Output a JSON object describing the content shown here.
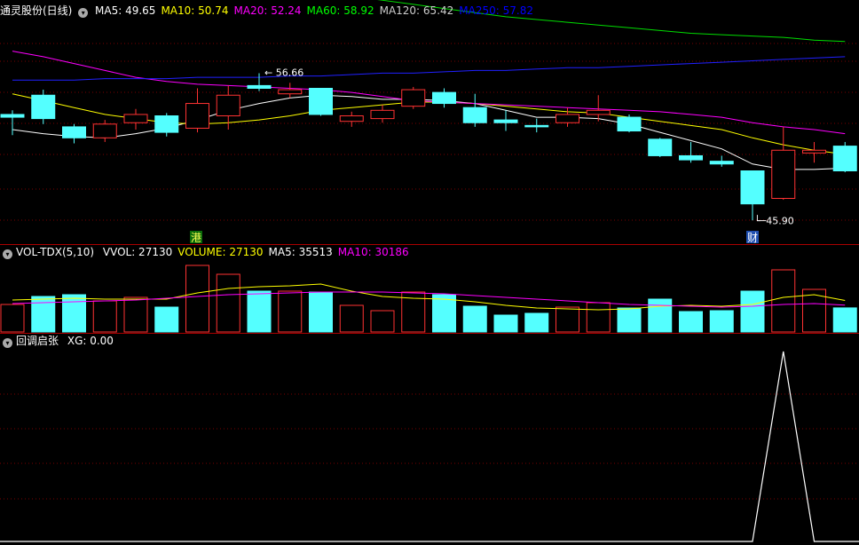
{
  "main": {
    "title": "通灵股份(日线)",
    "ma_labels": [
      {
        "key": "MA5",
        "value": "49.65",
        "color": "#ffffff"
      },
      {
        "key": "MA10",
        "value": "50.74",
        "color": "#ffff00"
      },
      {
        "key": "MA20",
        "value": "52.24",
        "color": "#ff00ff"
      },
      {
        "key": "MA60",
        "value": "58.92",
        "color": "#00ff00"
      },
      {
        "key": "MA120",
        "value": "65.42",
        "color": "#cccccc"
      },
      {
        "key": "MA250",
        "value": "57.82",
        "color": "#0000ff"
      }
    ],
    "high_label": "56.66",
    "low_label": "45.90",
    "marker_gang": "港",
    "marker_cai": "财"
  },
  "volume": {
    "title": "VOL-TDX(5,10)",
    "labels": [
      {
        "text": "VVOL: 27130",
        "color": "#ffffff"
      },
      {
        "text": "VOLUME: 27130",
        "color": "#ffff00"
      },
      {
        "text": "MA5: 35513",
        "color": "#ffffff"
      },
      {
        "text": "MA10: 30186",
        "color": "#ff00ff"
      }
    ]
  },
  "indicator": {
    "title": "回调启张",
    "labels": [
      {
        "text": "XG: 0.00",
        "color": "#ffffff"
      }
    ]
  },
  "chart_data": [
    {
      "type": "candlestick",
      "price_range": [
        44.5,
        60.5
      ],
      "candles": [
        {
          "o": 53.6,
          "c": 53.4,
          "h": 53.9,
          "l": 52.1,
          "up": false
        },
        {
          "o": 53.3,
          "c": 55.0,
          "h": 55.4,
          "l": 52.9,
          "up": false
        },
        {
          "o": 51.9,
          "c": 52.7,
          "h": 52.9,
          "l": 51.5,
          "up": false
        },
        {
          "o": 51.9,
          "c": 52.9,
          "h": 53.2,
          "l": 51.6,
          "up": true
        },
        {
          "o": 53.0,
          "c": 53.6,
          "h": 54.0,
          "l": 52.5,
          "up": true
        },
        {
          "o": 52.3,
          "c": 53.5,
          "h": 53.7,
          "l": 52.0,
          "up": false
        },
        {
          "o": 52.6,
          "c": 54.4,
          "h": 55.5,
          "l": 52.3,
          "up": true
        },
        {
          "o": 53.5,
          "c": 55.0,
          "h": 55.7,
          "l": 52.5,
          "up": true
        },
        {
          "o": 55.7,
          "c": 55.5,
          "h": 56.6,
          "l": 55.3,
          "up": false
        },
        {
          "o": 55.1,
          "c": 55.4,
          "h": 55.9,
          "l": 54.8,
          "up": true
        },
        {
          "o": 53.6,
          "c": 55.5,
          "h": 55.5,
          "l": 53.5,
          "up": false
        },
        {
          "o": 53.1,
          "c": 53.5,
          "h": 53.8,
          "l": 52.7,
          "up": true
        },
        {
          "o": 53.3,
          "c": 53.9,
          "h": 54.3,
          "l": 53.0,
          "up": true
        },
        {
          "o": 54.2,
          "c": 55.4,
          "h": 55.6,
          "l": 54.0,
          "up": true
        },
        {
          "o": 55.2,
          "c": 54.4,
          "h": 55.5,
          "l": 54.1,
          "up": false
        },
        {
          "o": 54.1,
          "c": 53.0,
          "h": 55.1,
          "l": 52.7,
          "up": false
        },
        {
          "o": 53.2,
          "c": 53.0,
          "h": 53.9,
          "l": 52.4,
          "up": false
        },
        {
          "o": 52.8,
          "c": 52.7,
          "h": 53.3,
          "l": 52.3,
          "up": false
        },
        {
          "o": 53.0,
          "c": 53.6,
          "h": 54.1,
          "l": 52.7,
          "up": true
        },
        {
          "o": 53.6,
          "c": 53.9,
          "h": 55.0,
          "l": 53.1,
          "up": true
        },
        {
          "o": 53.4,
          "c": 52.4,
          "h": 53.6,
          "l": 52.3,
          "up": false
        },
        {
          "o": 51.8,
          "c": 50.6,
          "h": 51.9,
          "l": 50.5,
          "up": false
        },
        {
          "o": 50.6,
          "c": 50.3,
          "h": 51.6,
          "l": 50.1,
          "up": false
        },
        {
          "o": 50.2,
          "c": 50.0,
          "h": 50.6,
          "l": 49.8,
          "up": false
        },
        {
          "o": 49.5,
          "c": 47.1,
          "h": 49.5,
          "l": 45.9,
          "up": false
        },
        {
          "o": 47.5,
          "c": 51.0,
          "h": 52.7,
          "l": 47.4,
          "up": true
        },
        {
          "o": 50.8,
          "c": 51.0,
          "h": 51.6,
          "l": 50.1,
          "up": true
        },
        {
          "o": 49.5,
          "c": 51.3,
          "h": 51.6,
          "l": 49.4,
          "up": false
        }
      ],
      "ma_lines": {
        "MA5": [
          52.5,
          52.2,
          52.0,
          51.9,
          52.2,
          52.6,
          53.2,
          53.9,
          54.4,
          54.8,
          55.0,
          54.9,
          54.7,
          54.7,
          54.6,
          54.4,
          53.9,
          53.4,
          53.4,
          53.3,
          52.9,
          52.3,
          51.7,
          51.1,
          50.0,
          49.6,
          49.6,
          49.7
        ],
        "MA10": [
          55.1,
          54.6,
          54.1,
          53.6,
          53.3,
          53.0,
          52.9,
          53.0,
          53.2,
          53.5,
          53.9,
          54.1,
          54.3,
          54.5,
          54.5,
          54.4,
          54.2,
          54.0,
          53.8,
          53.7,
          53.4,
          53.1,
          52.8,
          52.5,
          51.9,
          51.4,
          51.0,
          50.7
        ],
        "MA20": [
          58.2,
          57.8,
          57.3,
          56.8,
          56.3,
          56.0,
          55.8,
          55.7,
          55.6,
          55.5,
          55.4,
          55.2,
          54.9,
          54.6,
          54.5,
          54.4,
          54.3,
          54.2,
          54.1,
          54.0,
          53.9,
          53.8,
          53.6,
          53.4,
          53.0,
          52.7,
          52.5,
          52.2
        ],
        "MA60": [
          66.2,
          66.0,
          65.7,
          65.4,
          65.0,
          64.6,
          64.2,
          63.8,
          63.4,
          63.0,
          62.6,
          62.2,
          61.9,
          61.6,
          61.3,
          61.0,
          60.7,
          60.5,
          60.3,
          60.1,
          59.9,
          59.7,
          59.5,
          59.4,
          59.3,
          59.2,
          59.0,
          58.9
        ],
        "MA120": [
          70.5,
          70.3,
          70.1,
          69.9,
          69.7,
          69.5,
          69.3,
          69.1,
          68.8,
          68.5,
          68.2,
          68.0,
          67.8,
          67.6,
          67.4,
          67.2,
          67.0,
          66.8,
          66.6,
          66.4,
          66.3,
          66.2,
          66.1,
          66.0,
          65.8,
          65.7,
          65.6,
          65.4
        ],
        "MA250": [
          56.1,
          56.1,
          56.1,
          56.2,
          56.2,
          56.2,
          56.3,
          56.3,
          56.3,
          56.4,
          56.4,
          56.5,
          56.6,
          56.6,
          56.7,
          56.8,
          56.8,
          56.9,
          57.0,
          57.0,
          57.1,
          57.2,
          57.3,
          57.4,
          57.5,
          57.6,
          57.7,
          57.8
        ]
      }
    },
    {
      "type": "bar",
      "name": "volume",
      "range": [
        0,
        80000
      ],
      "values": [
        31000,
        40000,
        42000,
        35000,
        39000,
        28000,
        75000,
        65000,
        46000,
        46000,
        45000,
        30000,
        24000,
        45000,
        42000,
        29000,
        19000,
        21000,
        28000,
        33000,
        27000,
        37000,
        23000,
        24000,
        46000,
        70000,
        48000,
        27130
      ],
      "up": [
        true,
        false,
        false,
        true,
        true,
        false,
        true,
        true,
        false,
        true,
        false,
        true,
        true,
        true,
        false,
        false,
        false,
        false,
        true,
        true,
        false,
        false,
        false,
        false,
        false,
        true,
        true,
        false
      ],
      "ma_lines": {
        "MA5": [
          36000,
          37000,
          38000,
          37000,
          37000,
          37000,
          44000,
          49000,
          51000,
          52000,
          54000,
          46000,
          40000,
          38000,
          37000,
          34000,
          30000,
          27000,
          26000,
          25000,
          26000,
          29000,
          30000,
          29000,
          31000,
          39000,
          42000,
          35513
        ],
        "MA10": [
          32000,
          33000,
          34000,
          35000,
          36000,
          38000,
          40000,
          42000,
          43000,
          44000,
          45000,
          45000,
          45000,
          44000,
          43000,
          41000,
          39000,
          37000,
          35000,
          33000,
          31000,
          30000,
          29000,
          28000,
          29000,
          31000,
          32000,
          30186
        ]
      }
    },
    {
      "type": "line",
      "name": "XG",
      "range": [
        0,
        1
      ],
      "values": [
        0,
        0,
        0,
        0,
        0,
        0,
        0,
        0,
        0,
        0,
        0,
        0,
        0,
        0,
        0,
        0,
        0,
        0,
        0,
        0,
        0,
        0,
        0,
        0,
        0,
        1,
        0,
        0
      ]
    }
  ]
}
